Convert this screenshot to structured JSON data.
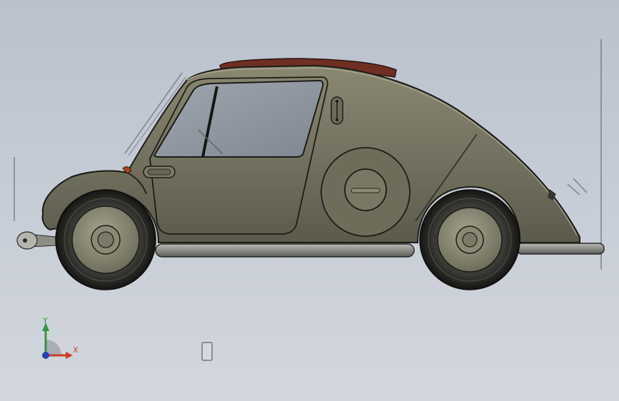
{
  "viewport": {
    "background_top": "#b9c1cd",
    "background_bottom": "#d3d7dd"
  },
  "model": {
    "icon": "car-3d-model",
    "body_color": "#76745f",
    "roof_color": "#6e2f22"
  },
  "triad": {
    "y_label": "Y",
    "x_label": "X",
    "y_color": "#2e9b3a",
    "x_color": "#d23a2a",
    "z_color": "#2a3fb6"
  },
  "view_widget": {
    "icon": "view-orientation-icon"
  }
}
